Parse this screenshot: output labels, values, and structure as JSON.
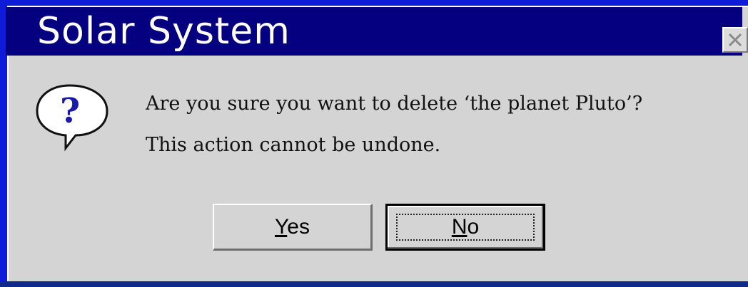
{
  "dialog": {
    "title": "Solar System",
    "message_line1": "Are you sure you want to delete ‘the planet Pluto’?",
    "message_line2": "This action cannot be undone.",
    "icon": "question-icon",
    "buttons": {
      "yes": {
        "mnemonic": "Y",
        "rest": "es"
      },
      "no": {
        "mnemonic": "N",
        "rest": "o"
      }
    }
  },
  "colors": {
    "desktop": "#0e1bd8",
    "titlebar": "#050080",
    "dialog_face": "#d4d4d4",
    "icon_glyph": "#1a1aa8"
  }
}
